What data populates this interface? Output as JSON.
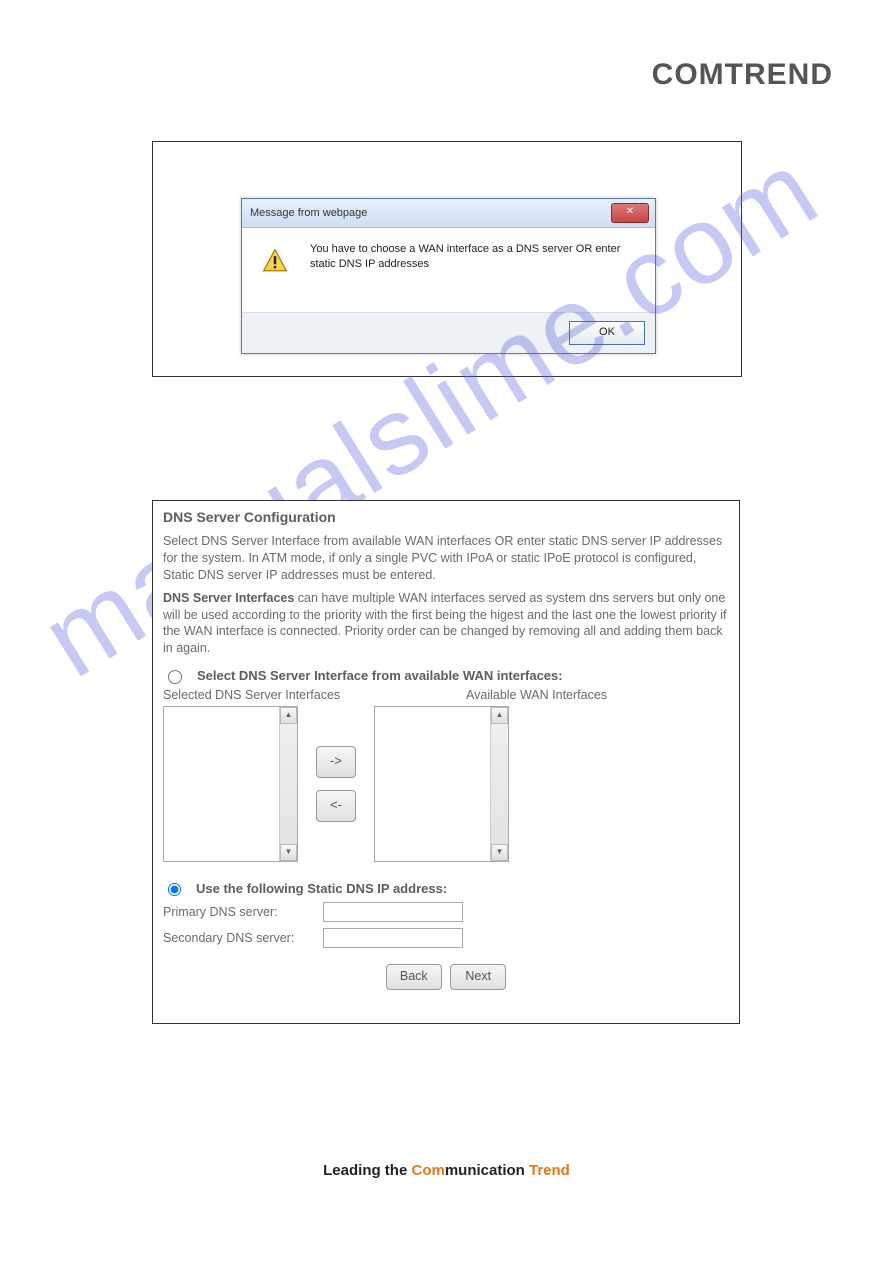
{
  "brand": "COMTREND",
  "dialog": {
    "title": "Message from webpage",
    "close": "✕",
    "msg": "You have to choose a WAN interface as a DNS server OR enter static DNS IP addresses",
    "ok": "OK"
  },
  "config": {
    "title": "DNS Server Configuration",
    "para1": "Select DNS Server Interface from available WAN interfaces OR enter static DNS server IP addresses for the system. In ATM mode, if only a single PVC with IPoA or static IPoE protocol is configured, Static DNS server IP addresses must be entered.",
    "para2_bold": "DNS Server Interfaces",
    "para2_rest": " can have multiple WAN interfaces served as system dns servers but only one will be used according to the priority with the first being the higest and the last one the lowest priority if the WAN interface is connected. Priority order can be changed by removing all and adding them back in again.",
    "option1_label": "Select DNS Server Interface from available WAN interfaces:",
    "left_list_label": "Selected DNS Server Interfaces",
    "right_list_label": "Available WAN Interfaces",
    "btn_right": "->",
    "btn_left": "<-",
    "option2_label": "Use the following Static DNS IP address:",
    "primary_label": "Primary DNS server:",
    "secondary_label": "Secondary DNS server:",
    "primary_value": "",
    "secondary_value": "",
    "back": "Back",
    "next": "Next"
  },
  "footer": {
    "lead": "Leading the ",
    "com": "Com",
    "munication": "munication ",
    "trend": "Trend"
  },
  "watermark": "manualslime.com"
}
